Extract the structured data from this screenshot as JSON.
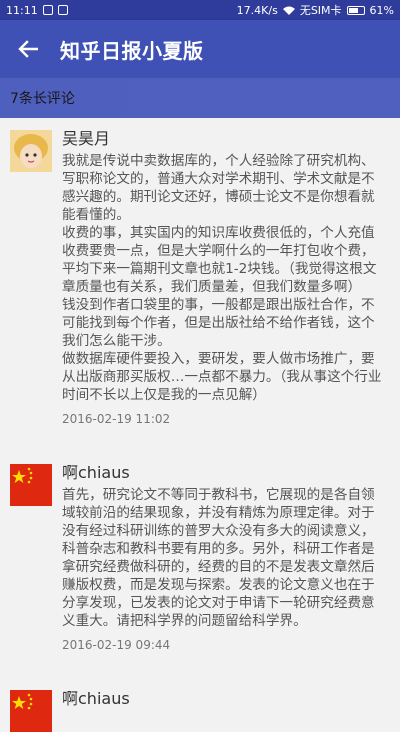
{
  "status": {
    "time": "11:11",
    "speed": "17.4K/s",
    "sim": "无SIM卡",
    "battery": "61%"
  },
  "toolbar": {
    "title": "知乎日报小夏版"
  },
  "subheader": {
    "count_label": "7条长评论"
  },
  "comments": [
    {
      "author": "吴昊月",
      "content": "我就是传说中卖数据库的，个人经验除了研究机构、写职称论文的，普通大众对学术期刊、学术文献是不感兴趣的。期刊论文还好，博硕士论文不是你想看就能看懂的。\n收费的事，其实国内的知识库收费很低的，个人充值收费要贵一点，但是大学啊什么的一年打包收个费，平均下来一篇期刊文章也就1-2块钱。（我觉得这根文章质量也有关系，我们质量差，但我们数量多啊）\n钱没到作者口袋里的事，一般都是跟出版社合作，不可能找到每个作者，但是出版社给不给作者钱，这个我们怎么能干涉。\n做数据库硬件要投入，要研发，要人做市场推广，要从出版商那买版权…一点都不暴力。（我从事这个行业时间不长以上仅是我的一点见解）",
      "time": "2016-02-19 11:02"
    },
    {
      "author": "啊chiaus",
      "content": "首先，研究论文不等同于教科书，它展现的是各自领域较前沿的结果现象，并没有精炼为原理定律。对于没有经过科研训练的普罗大众没有多大的阅读意义，科普杂志和教科书要有用的多。另外，科研工作者是拿研究经费做科研的，经费的目的不是发表文章然后赚版权费，而是发现与探索。发表的论文意义也在于分享发现，已发表的论文对于申请下一轮研究经费意义重大。请把科学界的问题留给科学界。",
      "time": "2016-02-19 09:44"
    },
    {
      "author": "啊chiaus",
      "content": "",
      "time": ""
    }
  ]
}
